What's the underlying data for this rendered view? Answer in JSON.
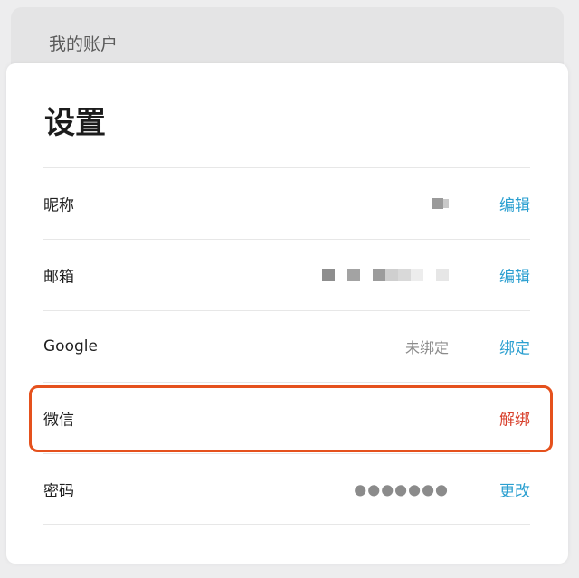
{
  "header": {
    "account_title": "我的账户"
  },
  "settings": {
    "title": "设置",
    "rows": [
      {
        "label": "昵称",
        "value": "",
        "value_redacted": true,
        "action": "编辑",
        "action_color": "#2a9fd0"
      },
      {
        "label": "邮箱",
        "value": "",
        "value_redacted": true,
        "action": "编辑",
        "action_color": "#2a9fd0"
      },
      {
        "label": "Google",
        "value": "未绑定",
        "action": "绑定",
        "action_color": "#2a9fd0"
      },
      {
        "label": "微信",
        "value": "",
        "action": "解绑",
        "action_color": "#d8412d",
        "highlighted": true,
        "highlight_color": "#e5511d"
      },
      {
        "label": "密码",
        "value": "●●●●●●●",
        "action": "更改",
        "action_color": "#2a9fd0"
      }
    ]
  }
}
